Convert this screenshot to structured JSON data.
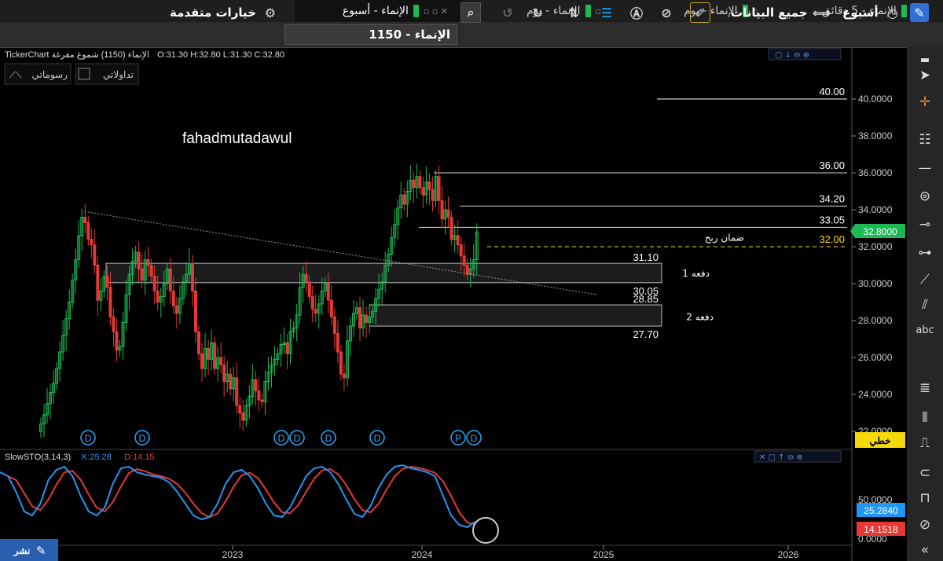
{
  "tabs": [
    {
      "label": "الإنماء - 5 دقائق",
      "active": false
    },
    {
      "label": "الإنماء - يوم",
      "active": false
    },
    {
      "label": "الإنماء - يوم",
      "active": false
    },
    {
      "label": "الإنماء - أسبوع",
      "active": true
    }
  ],
  "toolbar": {
    "period_label": "أسبوع",
    "range_label": "جميع البيانات",
    "symbol_value": "1150 - الإنماء",
    "advanced_label": "خيارات متقدمة"
  },
  "chart_header": {
    "title": "TickerChart الإنماء (1150) شموع مفرغة",
    "ohlc": "O:31.30  H:32.80  L:31.30  C:32.80",
    "tab_mine": "تداولاتي",
    "tab_drawings": "رسوماتي"
  },
  "watermark": "fahadmutadawul",
  "badges": {
    "last_price": "32.8000",
    "indicator_badge": "خطي",
    "share_label": "نشر"
  },
  "chart_data": {
    "type": "candlestick",
    "ylim": [
      22,
      42
    ],
    "yticks": [
      "40.0000",
      "38.0000",
      "36.0000",
      "34.0000",
      "32.0000",
      "30.0000",
      "28.0000",
      "26.0000",
      "24.0000",
      "22.0000"
    ],
    "xticks": [
      "2023",
      "2024",
      "2025",
      "2026"
    ],
    "closes": [
      22.4,
      22.9,
      23.5,
      24.1,
      24.6,
      25.4,
      26.3,
      27.2,
      28.1,
      29.0,
      30.2,
      31.3,
      32.6,
      33.6,
      33.3,
      32.4,
      32.1,
      31.0,
      29.1,
      29.6,
      30.4,
      29.8,
      28.2,
      27.4,
      26.4,
      26.6,
      27.9,
      29.4,
      30.5,
      31.2,
      31.7,
      30.8,
      30.2,
      31.3,
      31.0,
      30.4,
      29.6,
      29.0,
      29.3,
      30.0,
      30.8,
      29.6,
      28.8,
      28.4,
      29.2,
      30.1,
      30.5,
      31.1,
      29.6,
      27.4,
      26.2,
      25.4,
      26.5,
      25.9,
      26.8,
      25.4,
      26.0,
      25.6,
      24.7,
      25.1,
      24.3,
      24.9,
      23.4,
      23.0,
      22.6,
      23.4,
      23.9,
      24.8,
      24.2,
      23.7,
      23.6,
      24.7,
      25.2,
      25.6,
      25.9,
      26.2,
      26.7,
      26.8,
      26.2,
      27.4,
      27.6,
      28.3,
      29.8,
      30.5,
      30.1,
      29.3,
      28.6,
      28.4,
      28.9,
      29.6,
      30.0,
      29.1,
      28.2,
      27.3,
      26.3,
      25.1,
      24.9,
      26.9,
      27.7,
      28.4,
      28.7,
      27.6,
      28.3,
      27.9,
      28.2,
      28.5,
      29.2,
      29.7,
      30.1,
      31.0,
      31.6,
      32.5,
      33.2,
      34.1,
      34.8,
      34.3,
      35.0,
      35.6,
      35.2,
      35.8,
      35.2,
      34.8,
      35.5,
      35.1,
      34.5,
      35.8,
      34.5,
      33.5,
      34.0,
      33.6,
      32.4,
      32.6,
      32.1,
      31.5,
      31.0,
      30.5,
      30.8,
      31.3,
      32.8
    ],
    "levels": [
      40.0,
      36.0,
      34.2,
      33.05,
      32.0,
      31.1,
      30.05,
      28.85,
      27.7
    ],
    "level_labels": [
      "40.00",
      "36.00",
      "34.20",
      "33.05",
      "32.00",
      "31.10",
      "30.05",
      "28.85",
      "27.70"
    ],
    "zone_labels": [
      "دفعه 1",
      "دفعه 2"
    ],
    "target_label": "ضمان ربح",
    "event_markers": [
      "D",
      "D",
      "D",
      "D",
      "D",
      "D",
      "P",
      "D"
    ],
    "indicator": {
      "title": "SlowSTO(3,14,3)",
      "k_label": "K:25.28",
      "d_label": "D:14.15",
      "k_value": "25.2840",
      "d_value": "14.1518",
      "yticks": [
        "50.0000",
        "0.0000"
      ],
      "k_color": "#2196f3",
      "d_color": "#e53935"
    }
  }
}
